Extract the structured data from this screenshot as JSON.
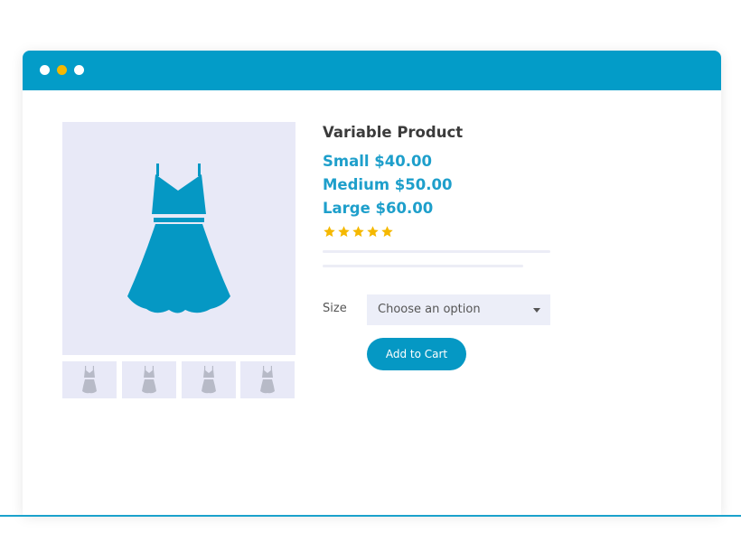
{
  "window": {
    "titlebar_color": "#039cc8",
    "controls": [
      {
        "name": "close",
        "color": "#ffffff"
      },
      {
        "name": "minimize",
        "color": "#f5b800"
      },
      {
        "name": "maximize",
        "color": "#ffffff"
      }
    ]
  },
  "gallery": {
    "main_image_icon": "dress-icon",
    "main_image_color": "#0598c4",
    "thumbnail_icon": "dress-icon",
    "thumbnail_color": "#b7bac7",
    "thumbnail_count": 4
  },
  "product": {
    "title": "Variable Product",
    "prices": [
      "Small $40.00",
      "Medium $50.00",
      "Large $60.00"
    ],
    "price_color": "#1e9fcb",
    "rating": 5,
    "rating_max": 5,
    "star_color": "#f5b800"
  },
  "form": {
    "size_label": "Size",
    "size_select_value": "Choose an option",
    "add_to_cart_label": "Add to Cart",
    "button_color": "#0598c4"
  }
}
